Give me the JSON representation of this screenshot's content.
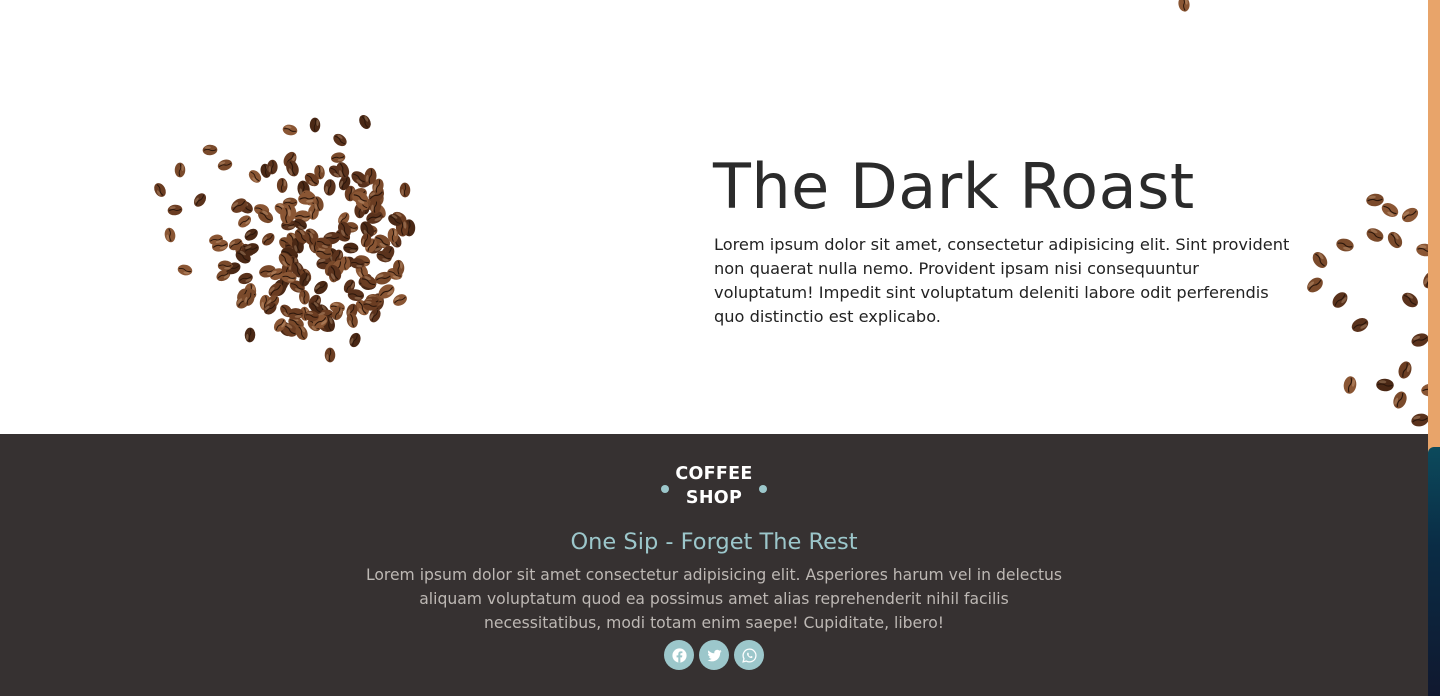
{
  "hero": {
    "title": "The Dark Roast",
    "text": "Lorem ipsum dolor sit amet, consectetur adipisicing elit. Sint provident non quaerat nulla nemo. Provident ipsam nisi consequuntur voluptatum! Impedit sint voluptatum deleniti labore odit perferendis quo distinctio est explicabo."
  },
  "footer": {
    "logo_line1": "COFFEE",
    "logo_line2": "SHOP",
    "tagline": "One Sip - Forget The Rest",
    "text": "Lorem ipsum dolor sit amet consectetur adipisicing elit. Asperiores harum vel in delectus aliquam voluptatum quod ea possimus amet alias reprehenderit nihil facilis necessitatibus, modi totam enim saepe! Cupiditate, libero!",
    "socials": [
      "facebook-icon",
      "twitter-icon",
      "whatsapp-icon"
    ]
  },
  "colors": {
    "footer_bg": "#363131",
    "accent": "#9cc7cb",
    "scrollbar_track": "#e8a46a",
    "bean": "#6b3d22"
  }
}
